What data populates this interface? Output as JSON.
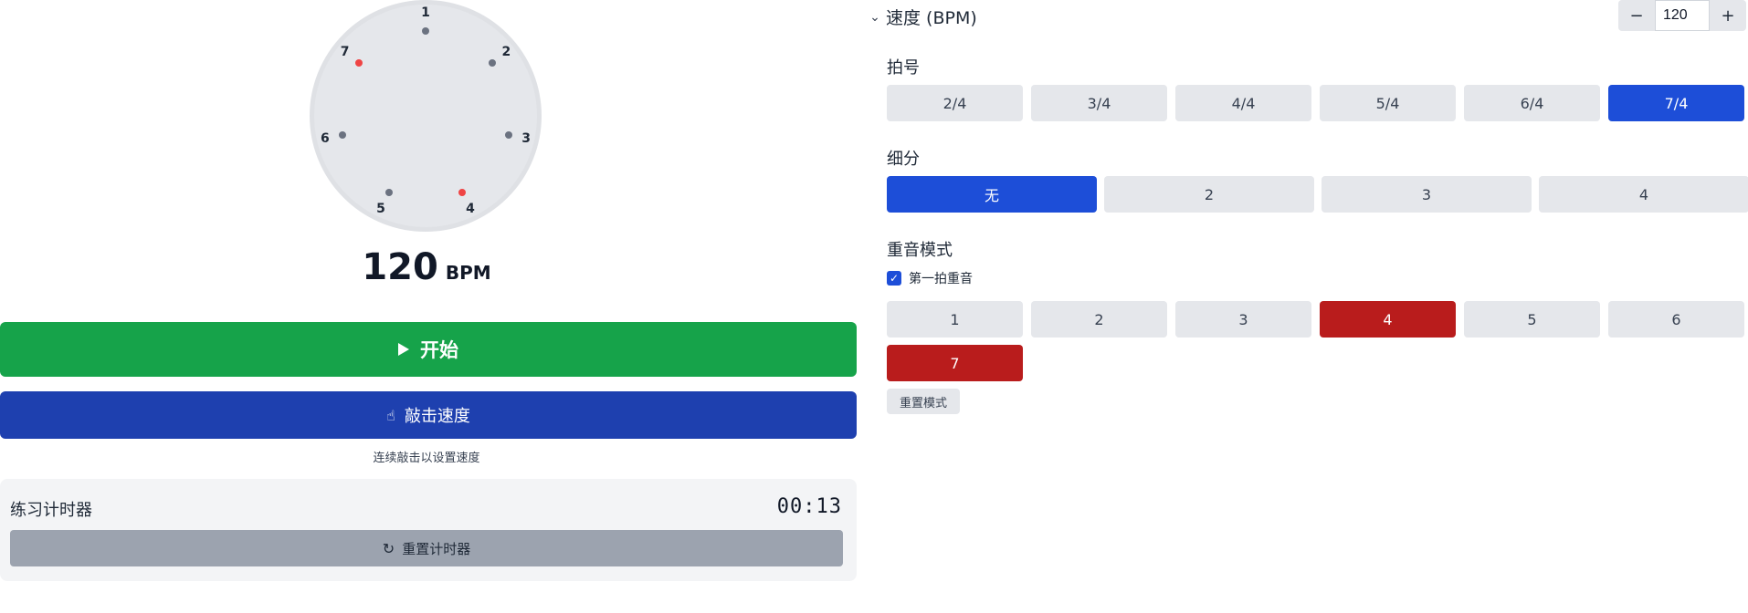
{
  "visualizer": {
    "beats": [
      {
        "number": "1",
        "accent": false
      },
      {
        "number": "2",
        "accent": false
      },
      {
        "number": "3",
        "accent": false
      },
      {
        "number": "4",
        "accent": true
      },
      {
        "number": "5",
        "accent": false
      },
      {
        "number": "6",
        "accent": false
      },
      {
        "number": "7",
        "accent": true
      }
    ],
    "accent_color": "#ef4444",
    "beat_color": "#6b7280"
  },
  "bpm_display": {
    "value": "120",
    "unit": "BPM"
  },
  "controls": {
    "start_label": "开始",
    "tap_label": "敲击速度",
    "tap_hint": "连续敲击以设置速度"
  },
  "timer": {
    "label": "练习计时器",
    "value": "00:13",
    "reset_label": "重置计时器"
  },
  "tempo": {
    "label": "速度 (BPM)",
    "value": "120",
    "minus": "−",
    "plus": "+"
  },
  "time_signature": {
    "label": "拍号",
    "options": [
      "2/4",
      "3/4",
      "4/4",
      "5/4",
      "6/4",
      "7/4"
    ],
    "selected": "7/4"
  },
  "subdivision": {
    "label": "细分",
    "options": [
      "无",
      "2",
      "3",
      "4"
    ],
    "selected": "无"
  },
  "accent_pattern": {
    "label": "重音模式",
    "first_beat_label": "第一拍重音",
    "first_beat_checked": true,
    "beats": [
      "1",
      "2",
      "3",
      "4",
      "5",
      "6",
      "7"
    ],
    "accented": [
      "4",
      "7"
    ],
    "reset_label": "重置模式"
  },
  "colors": {
    "start": "#16a34a",
    "tap": "#1e40af",
    "selected": "#1d4ed8",
    "accent": "#b91c1c"
  }
}
